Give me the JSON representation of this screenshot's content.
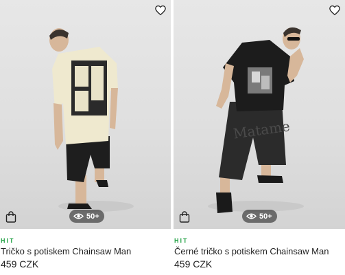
{
  "products": [
    {
      "badge": "HIT",
      "title": "Tričko s potiskem Chainsaw Man",
      "price": "459 CZK",
      "views": "50+",
      "favorite_icon": "heart-outline-icon",
      "cart_icon": "shopping-bag-icon",
      "views_icon": "eye-icon",
      "shirt_color": "#efe9cf"
    },
    {
      "badge": "HIT",
      "title": "Černé tričko s potiskem Chainsaw Man",
      "price": "459 CZK",
      "views": "50+",
      "favorite_icon": "heart-outline-icon",
      "cart_icon": "shopping-bag-icon",
      "views_icon": "eye-icon",
      "shirt_color": "#1c1c1c"
    }
  ],
  "colors": {
    "badge": "#27a349",
    "text": "#222222",
    "photo_bg": "#e2e2e2"
  }
}
